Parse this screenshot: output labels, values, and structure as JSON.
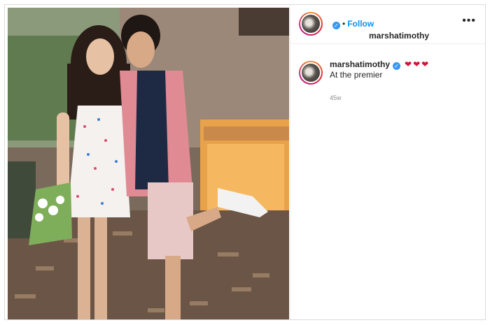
{
  "post": {
    "username": "marshatimothy",
    "verified": true,
    "separator": "•",
    "follow_label": "Follow",
    "more_icon": "more-options-icon",
    "caption_username": "marshatimothy",
    "caption_emoji": "❤❤❤",
    "caption_text": "At the premier",
    "timestamp": "45w"
  },
  "colors": {
    "accent": "#0095f6",
    "verified": "#3897f0",
    "muted": "#8e8e8e",
    "text": "#262626"
  }
}
